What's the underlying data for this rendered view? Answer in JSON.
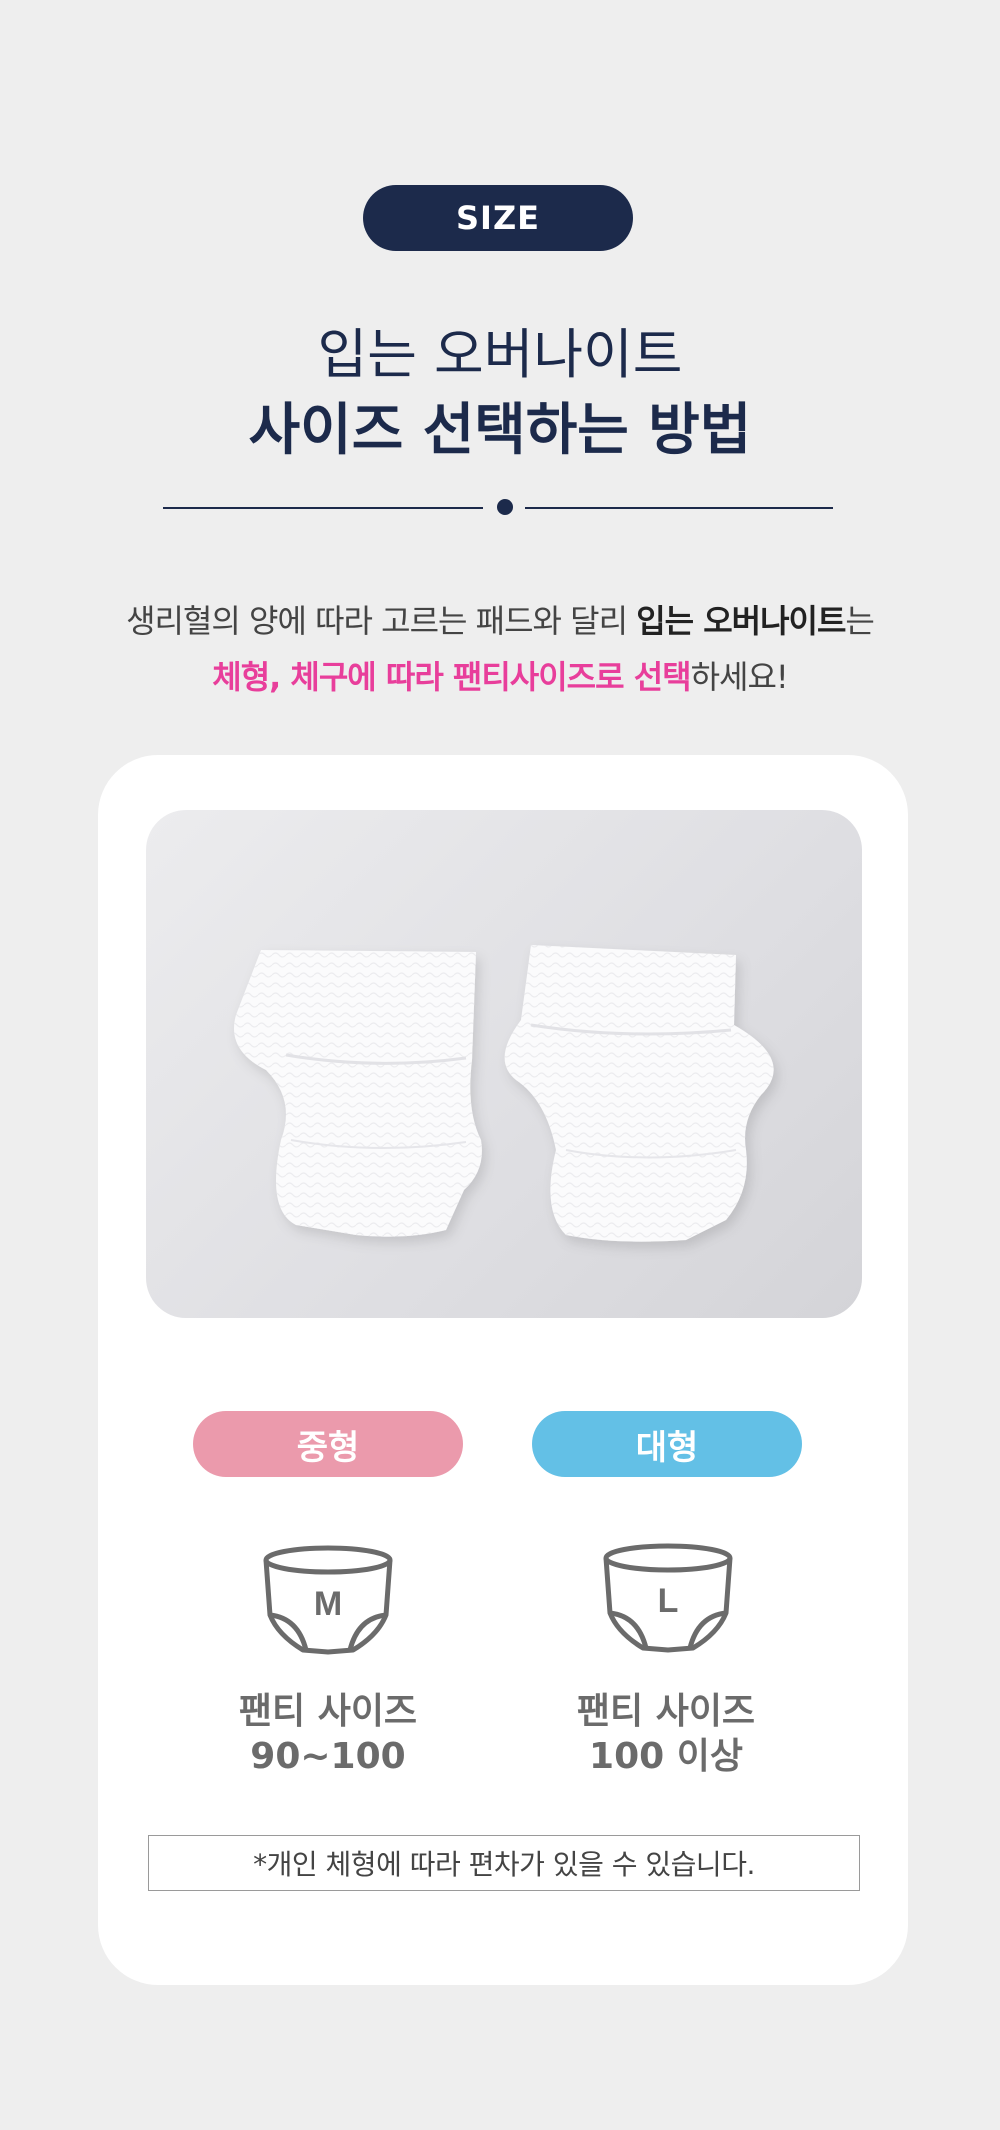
{
  "badge": "SIZE",
  "title": {
    "line1": "입는 오버나이트",
    "line2": "사이즈 선택하는 방법"
  },
  "description": {
    "line1_prefix": "생리혈의 양에 따라 고르는 패드와 달리 ",
    "line1_bold": "입는 오버나이트",
    "line1_suffix": "는",
    "line2_pink": "체형, 체구에 따라 팬티사이즈로 선택",
    "line2_suffix": "하세요!"
  },
  "sizes": [
    {
      "type_label": "중형",
      "icon_letter": "M",
      "name": "팬티 사이즈",
      "range": "90~100",
      "color": "#eb9aac"
    },
    {
      "type_label": "대형",
      "icon_letter": "L",
      "name": "팬티 사이즈",
      "range": "100 이상",
      "color": "#63c0e6"
    }
  ],
  "note": "*개인 체형에 따라 편차가 있을 수 있습니다.",
  "colors": {
    "navy": "#1c2a4b",
    "pink_text": "#e83e9b",
    "background": "#eeeeee",
    "card": "#ffffff"
  }
}
